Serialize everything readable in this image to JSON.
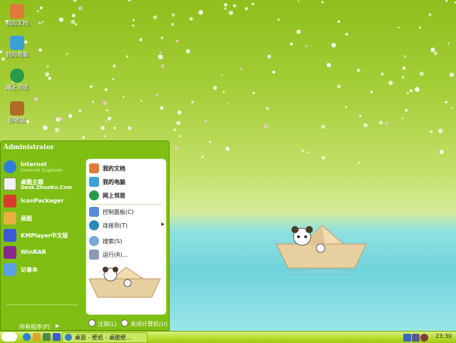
{
  "desktop": {
    "icons": [
      {
        "label": "我的文档",
        "icon": "folder-documents-icon",
        "color": "#e07a3c"
      },
      {
        "label": "我的电脑",
        "icon": "computer-icon",
        "color": "#3aa0d8"
      },
      {
        "label": "网上邻居",
        "icon": "network-globe-icon",
        "color": "#2a9a4a"
      },
      {
        "label": "回收站",
        "icon": "recycle-bin-icon",
        "color": "#b06a2a"
      }
    ]
  },
  "start_menu": {
    "user": "Administrator",
    "left_items": [
      {
        "title": "Internet",
        "subtitle": "Internet Explorer",
        "icon": "internet-explorer-icon",
        "color": "#2f7fd8"
      },
      {
        "title": "桌酷主题",
        "subtitle": "Desk.ZhuoKu.Com",
        "icon": "zhuoku-theme-icon",
        "color": "#f0f0f0"
      },
      {
        "title": "IconPackager",
        "icon": "iconpackager-icon",
        "color": "#d83a2a"
      },
      {
        "title": "画图",
        "icon": "paint-icon",
        "color": "#e8b040"
      },
      {
        "title": "KMPlayer中文版",
        "icon": "kmplayer-icon",
        "color": "#3a5ad8"
      },
      {
        "title": "WinRAR",
        "icon": "winrar-icon",
        "color": "#8a2a8a"
      },
      {
        "title": "记事本",
        "icon": "notepad-icon",
        "color": "#5aa0e8"
      }
    ],
    "all_programs": "所有程序(P)",
    "right_items": [
      {
        "label": "我的文档",
        "icon": "folder-documents-icon",
        "color": "#e07a3c",
        "bold": true
      },
      {
        "label": "我的电脑",
        "icon": "computer-icon",
        "color": "#3aa0d8",
        "bold": true
      },
      {
        "label": "网上邻居",
        "icon": "network-globe-icon",
        "color": "#2a9a4a",
        "bold": true
      },
      {
        "label": "控制面板(C)",
        "icon": "control-panel-icon",
        "color": "#5a8ad8",
        "bold": false
      },
      {
        "label": "连接到(T)",
        "icon": "connect-globe-icon",
        "color": "#2a8ab8",
        "bold": false,
        "submenu": true
      },
      {
        "label": "搜索(S)",
        "icon": "search-icon",
        "color": "#7aa6d8",
        "bold": false
      },
      {
        "label": "运行(R)...",
        "icon": "run-icon",
        "color": "#8a9ab8",
        "bold": false
      }
    ],
    "logoff": "注销(L)",
    "shutdown": "关闭计算机(U)"
  },
  "taskbar": {
    "start_icon": "apple-icon",
    "quick_launch": [
      {
        "icon": "ie-quick-icon",
        "color": "#2f7fd8"
      },
      {
        "icon": "folder-quick-icon",
        "color": "#e0a030"
      },
      {
        "icon": "mail-quick-icon",
        "color": "#4a8a4a"
      },
      {
        "icon": "media-quick-icon",
        "color": "#3a5ad8"
      }
    ],
    "task": "桌面 - 壁纸 - 桌酷壁...",
    "tray_icons": [
      {
        "icon": "network-tray-icon",
        "color": "#3a6ab8"
      },
      {
        "icon": "volume-tray-icon",
        "color": "#5a5a8a"
      },
      {
        "icon": "security-tray-icon",
        "color": "#8a3a3a"
      }
    ],
    "clock": "23:30"
  },
  "colors": {
    "menu_green": "#7fbf14",
    "taskbar_green": "#b4dc28"
  }
}
